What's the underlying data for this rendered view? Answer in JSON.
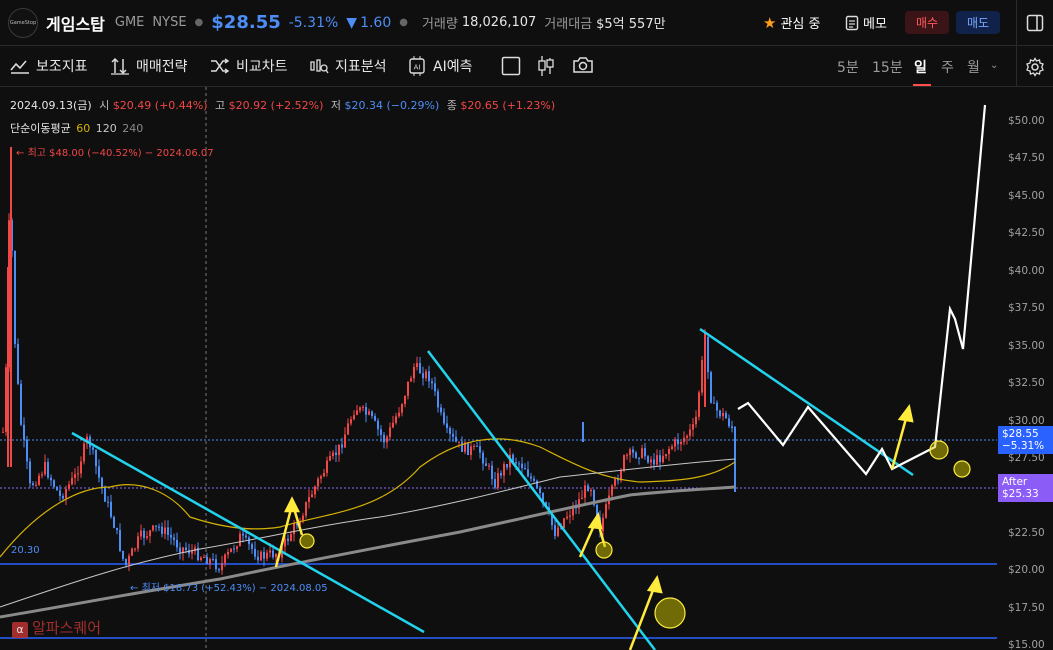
{
  "header": {
    "logo_text": "GameStop",
    "name": "게임스탑",
    "ticker": "GME",
    "exchange": "NYSE",
    "price": "$28.55",
    "change_pct": "-5.31%",
    "change_abs": "1.60",
    "volume_label": "거래량",
    "volume": "18,026,107",
    "turnover_label": "거래대금",
    "turnover": "$5억 557만",
    "watch_label": "관심 중",
    "memo_label": "메모",
    "buy_label": "매수",
    "sell_label": "매도"
  },
  "toolbar": {
    "items": [
      "보조지표",
      "매매전략",
      "비교차트",
      "지표분석",
      "AI예측"
    ],
    "timeframes": [
      "5분",
      "15분",
      "일",
      "주",
      "월"
    ],
    "active_timeframe": "일"
  },
  "info": {
    "date": "2024.09.13(금)",
    "open_label": "시",
    "open": "$20.49 (+0.44%)",
    "high_label": "고",
    "high": "$20.92 (+2.52%)",
    "low_label": "저",
    "low": "$20.34 (−0.29%)",
    "close_label": "종",
    "close": "$20.65 (+1.23%)",
    "ma_label": "단순이동평균",
    "ma_periods": [
      "60",
      "120",
      "240"
    ],
    "max_note": "최고 $48.00 (−40.52%) − 2024.06.07",
    "min_note": "최저 $18.73 (+52.43%) − 2024.08.05",
    "level_label": "20.30",
    "watermark": "알파스퀘어"
  },
  "axis": {
    "ticks": [
      "$50.00",
      "$47.50",
      "$45.00",
      "$42.50",
      "$40.00",
      "$37.50",
      "$35.00",
      "$32.50",
      "$30.00",
      "$27.50",
      "$25.00",
      "$22.50",
      "$20.00",
      "$17.50",
      "$15.00"
    ],
    "price_tag": "$28.55",
    "price_tag_pct": "−5.31%",
    "after_label": "After",
    "after_price": "$25.33"
  },
  "colors": {
    "up": "#f04747",
    "down": "#4d8df6",
    "trend": "#22d3ee",
    "arrow": "#ffeb3b"
  }
}
